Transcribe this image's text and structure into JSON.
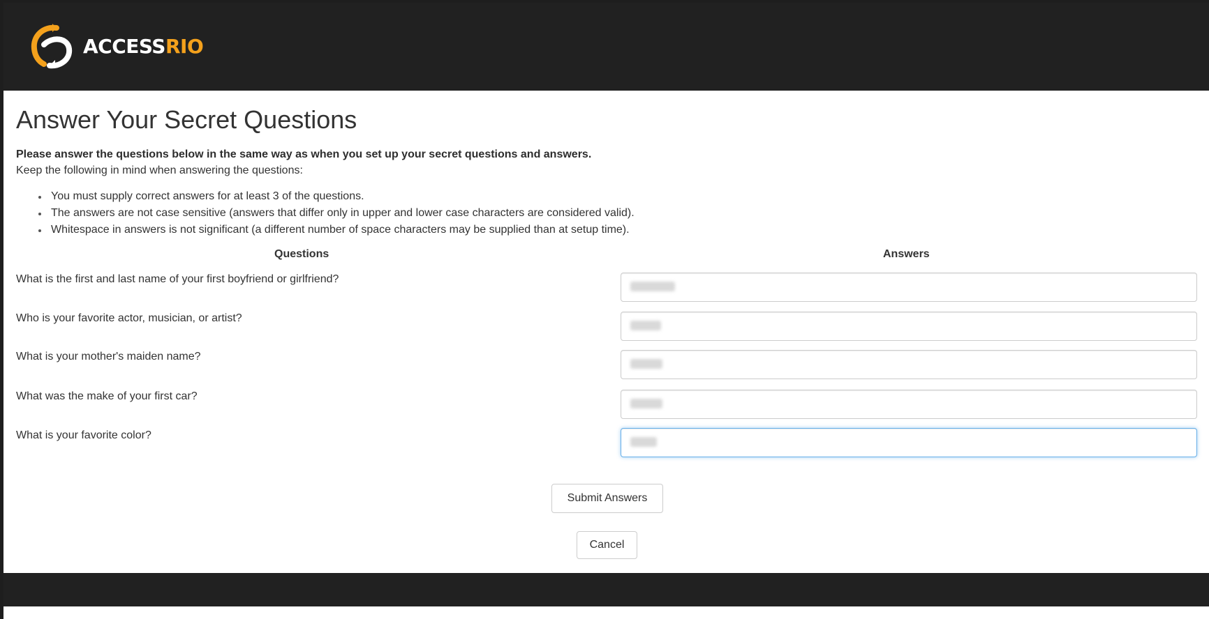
{
  "header": {
    "logo_text_white": "ACCESS",
    "logo_text_orange": "RIO",
    "brand_color": "#f4a11c",
    "logo_icon": "accessrio-swirl-icon"
  },
  "page": {
    "title": "Answer Your Secret Questions",
    "intro_bold": "Please answer the questions below in the same way as when you set up your secret questions and answers.",
    "intro_normal": "Keep the following in mind when answering the questions:",
    "rules": [
      "You must supply correct answers for at least 3 of the questions.",
      "The answers are not case sensitive (answers that differ only in upper and lower case characters are considered valid).",
      "Whitespace in answers is not significant (a different number of space characters may be supplied than at setup time)."
    ]
  },
  "table": {
    "questions_header": "Questions",
    "answers_header": "Answers",
    "rows": [
      {
        "question": "What is the first and last name of your first boyfriend or girlfriend?"
      },
      {
        "question": "Who is your favorite actor, musician, or artist?"
      },
      {
        "question": "What is your mother's maiden name?"
      },
      {
        "question": "What was the make of your first car?"
      },
      {
        "question": "What is your favorite color?"
      }
    ]
  },
  "actions": {
    "submit_label": "Submit Answers",
    "cancel_label": "Cancel"
  },
  "colors": {
    "header_bg": "#212121",
    "focus_border": "#66afe9"
  }
}
